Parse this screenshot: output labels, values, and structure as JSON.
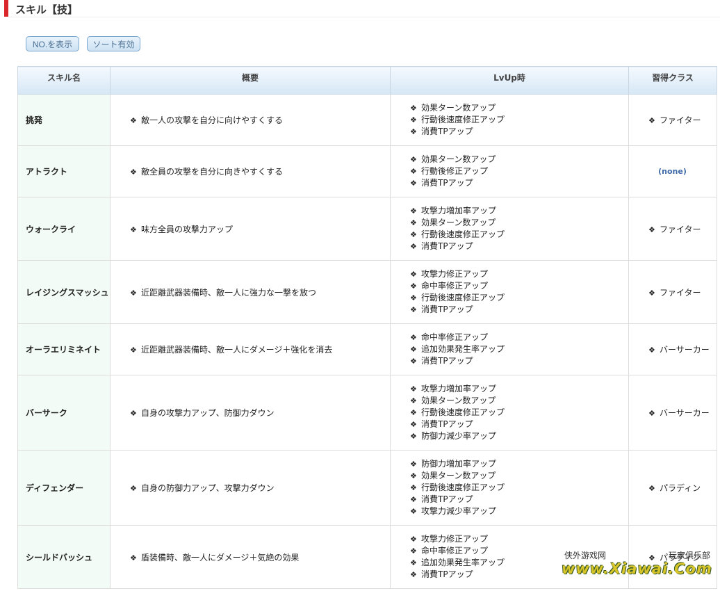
{
  "page": {
    "title": "スキル【技】"
  },
  "toolbar": {
    "show_no_label": "NO.を表示",
    "sort_label": "ソート有効"
  },
  "table": {
    "headers": [
      "スキル名",
      "概要",
      "LvUp時",
      "習得クラス"
    ],
    "bullet": "❖",
    "rows": [
      {
        "name": "挑発",
        "desc": "敵一人の攻撃を自分に向けやすくする",
        "lvup": [
          "効果ターン数アップ",
          "行動後速度修正アップ",
          "消費TPアップ"
        ],
        "class": "ファイター"
      },
      {
        "name": "アトラクト",
        "desc": "敵全員の攻撃を自分に向きやすくする",
        "lvup": [
          "効果ターン数アップ",
          "行動後修正アップ",
          "消費TPアップ"
        ],
        "class": "(none)"
      },
      {
        "name": "ウォークライ",
        "desc": "味方全員の攻撃力アップ",
        "lvup": [
          "攻撃力増加率アップ",
          "効果ターン数アップ",
          "行動後速度修正アップ",
          "消費TPアップ"
        ],
        "class": "ファイター"
      },
      {
        "name": "レイジングスマッシュ",
        "desc": "近距離武器装備時、敵一人に強力な一撃を放つ",
        "lvup": [
          "攻撃力修正アップ",
          "命中率修正アップ",
          "行動後速度修正アップ",
          "消費TPアップ"
        ],
        "class": "ファイター"
      },
      {
        "name": "オーラエリミネイト",
        "desc": "近距離武器装備時、敵一人にダメージ＋強化を消去",
        "lvup": [
          "命中率修正アップ",
          "追加効果発生率アップ",
          "消費TPアップ"
        ],
        "class": "バーサーカー"
      },
      {
        "name": "バーサーク",
        "desc": "自身の攻撃力アップ、防御力ダウン",
        "lvup": [
          "攻撃力増加率アップ",
          "効果ターン数アップ",
          "行動後速度修正アップ",
          "消費TPアップ",
          "防御力減少率アップ"
        ],
        "class": "バーサーカー"
      },
      {
        "name": "ディフェンダー",
        "desc": "自身の防御力アップ、攻撃力ダウン",
        "lvup": [
          "防御力増加率アップ",
          "効果ターン数アップ",
          "行動後速度修正アップ",
          "消費TPアップ",
          "攻撃力減少率アップ"
        ],
        "class": "パラディン"
      },
      {
        "name": "シールドバッシュ",
        "desc": "盾装備時、敵一人にダメージ＋気絶の効果",
        "lvup": [
          "攻撃力修正アップ",
          "命中率修正アップ",
          "追加効果発生率アップ",
          "消費TPアップ"
        ],
        "class": "パラディン"
      }
    ]
  },
  "watermark": {
    "site_cn": "侠外游戏网",
    "club_cn": "玩家俱乐部",
    "url": "www.Xiawai.Com"
  },
  "colors": {
    "accent": "#d9262a",
    "name_bg": "#f2fbf6",
    "header_bg": "#d6e7f6",
    "none_text": "#3f6aa8"
  }
}
